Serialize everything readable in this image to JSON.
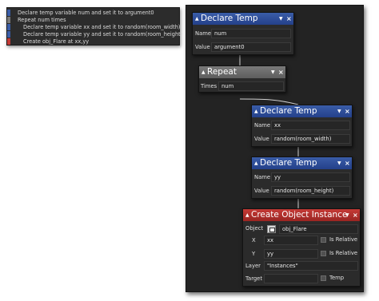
{
  "summary": {
    "lines": [
      "Declare temp variable num and set it to argument0",
      "Repeat num times",
      "Declare temp variable xx and set it to random(room_width)",
      "Declare temp variable yy and set it to random(room_height)",
      "Create obj_Flare at xx,yy"
    ]
  },
  "blocks": {
    "declare_num": {
      "title": "Declare Temp",
      "name_label": "Name",
      "name_value": "num",
      "value_label": "Value",
      "value_value": "argument0"
    },
    "repeat": {
      "title": "Repeat",
      "times_label": "Times",
      "times_value": "num"
    },
    "declare_xx": {
      "title": "Declare Temp",
      "name_label": "Name",
      "name_value": "xx",
      "value_label": "Value",
      "value_value": "random(room_width)"
    },
    "declare_yy": {
      "title": "Declare Temp",
      "name_label": "Name",
      "name_value": "yy",
      "value_label": "Value",
      "value_value": "random(room_height)"
    },
    "create_instance": {
      "title": "Create Object Instance",
      "object_label": "Object",
      "object_value": "obj_Flare",
      "x_label": "X",
      "x_value": "xx",
      "x_relative": "Is Relative",
      "y_label": "Y",
      "y_value": "yy",
      "y_relative": "Is Relative",
      "layer_label": "Layer",
      "layer_value": "\"Instances\"",
      "target_label": "Target",
      "target_value": "",
      "temp_label": "Temp"
    }
  },
  "icons": {
    "collapse": "▲",
    "menu": "▼",
    "close": "×"
  }
}
